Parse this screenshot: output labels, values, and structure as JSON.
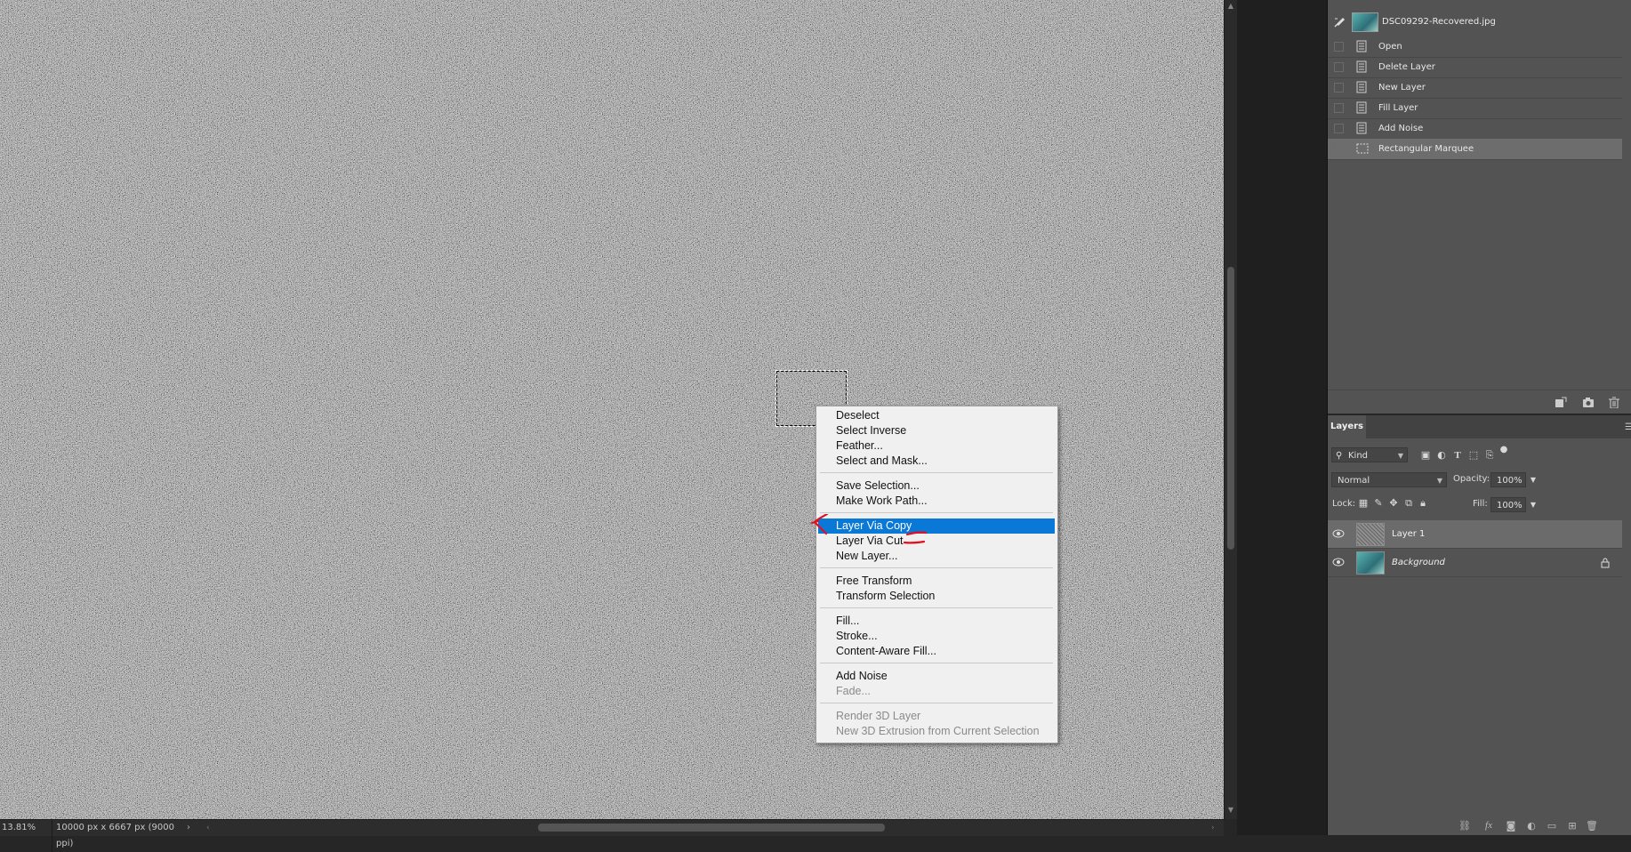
{
  "canvas": {
    "background": "#7a7a7a",
    "noise_light": "#bdbdbd",
    "noise_dark": "#3a3a3a"
  },
  "statusbar": {
    "zoom": "13.81%",
    "doc_info": "10000 px x 6667 px (9000 ppi)",
    "more_arrow": "›",
    "scroll_left": "‹",
    "scroll_right": "›"
  },
  "context_menu": {
    "groups": [
      [
        "Deselect",
        "Select Inverse",
        "Feather...",
        "Select and Mask..."
      ],
      [
        "Save Selection...",
        "Make Work Path..."
      ],
      [
        "Layer Via Copy",
        "Layer Via Cut",
        "New Layer..."
      ],
      [
        "Free Transform",
        "Transform Selection"
      ],
      [
        "Fill...",
        "Stroke...",
        "Content-Aware Fill..."
      ],
      [
        "Add Noise",
        "Fade..."
      ],
      [
        "Render 3D Layer",
        "New 3D Extrusion from Current Selection"
      ]
    ],
    "highlighted": "Layer Via Copy",
    "disabled": [
      "Fade...",
      "Render 3D Layer",
      "New 3D Extrusion from Current Selection"
    ],
    "highlight_color": "#0a78d7"
  },
  "history": {
    "snapshot_name": "DSC09292-Recovered.jpg",
    "states": [
      {
        "label": "Open",
        "icon": "document-icon"
      },
      {
        "label": "Delete Layer",
        "icon": "document-icon"
      },
      {
        "label": "New Layer",
        "icon": "document-icon"
      },
      {
        "label": "Fill Layer",
        "icon": "document-icon"
      },
      {
        "label": "Add Noise",
        "icon": "document-icon"
      },
      {
        "label": "Rectangular Marquee",
        "icon": "marquee-icon"
      }
    ],
    "selected_state": "Rectangular Marquee"
  },
  "layers_panel": {
    "tab": "Layers",
    "filter_kind": "Kind",
    "blend_mode": "Normal",
    "opacity_label": "Opacity:",
    "opacity_value": "100%",
    "lock_label": "Lock:",
    "fill_label": "Fill:",
    "fill_value": "100%",
    "layers": [
      {
        "name": "Layer 1",
        "selected": true,
        "visible": true,
        "locked": false
      },
      {
        "name": "Background",
        "selected": false,
        "visible": true,
        "locked": true
      }
    ]
  }
}
